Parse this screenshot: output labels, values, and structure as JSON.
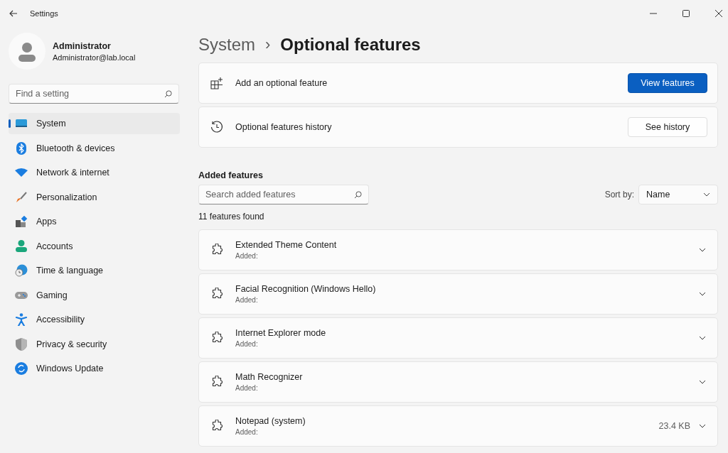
{
  "window": {
    "title": "Settings"
  },
  "account": {
    "name": "Administrator",
    "email": "Administrator@lab.local"
  },
  "search": {
    "placeholder": "Find a setting"
  },
  "sidebar": {
    "items": [
      {
        "label": "System",
        "selected": true
      },
      {
        "label": "Bluetooth & devices",
        "selected": false
      },
      {
        "label": "Network & internet",
        "selected": false
      },
      {
        "label": "Personalization",
        "selected": false
      },
      {
        "label": "Apps",
        "selected": false
      },
      {
        "label": "Accounts",
        "selected": false
      },
      {
        "label": "Time & language",
        "selected": false
      },
      {
        "label": "Gaming",
        "selected": false
      },
      {
        "label": "Accessibility",
        "selected": false
      },
      {
        "label": "Privacy & security",
        "selected": false
      },
      {
        "label": "Windows Update",
        "selected": false
      }
    ]
  },
  "breadcrumb": {
    "parent": "System",
    "separator": "›",
    "current": "Optional features"
  },
  "actions": [
    {
      "label": "Add an optional feature",
      "button": "View features",
      "primary": true
    },
    {
      "label": "Optional features history",
      "button": "See history",
      "primary": false
    }
  ],
  "added_features": {
    "heading": "Added features",
    "search_placeholder": "Search added features",
    "sort_label": "Sort by:",
    "sort_value": "Name",
    "count": "11 features found",
    "items": [
      {
        "name": "Extended Theme Content",
        "status": "Added:"
      },
      {
        "name": "Facial Recognition (Windows Hello)",
        "status": "Added:"
      },
      {
        "name": "Internet Explorer mode",
        "status": "Added:"
      },
      {
        "name": "Math Recognizer",
        "status": "Added:"
      },
      {
        "name": "Notepad (system)",
        "status": "Added:",
        "size": "23.4 KB"
      }
    ]
  }
}
